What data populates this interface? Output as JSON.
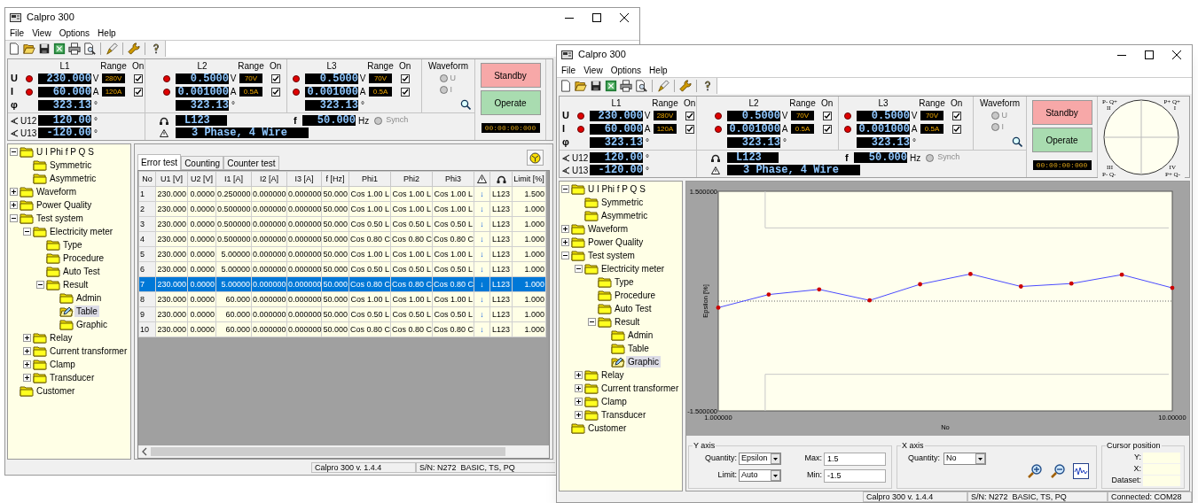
{
  "windows": [
    {
      "title": "Calpro 300",
      "menu": [
        "File",
        "View",
        "Options",
        "Help"
      ],
      "meter": {
        "row_labels": [
          "U",
          "I",
          "φ"
        ],
        "phases": [
          {
            "label": "L1",
            "range_header": "Range",
            "on_header": "On",
            "u": "230.000",
            "u_unit": "V",
            "u_range": "280V",
            "u_on": true,
            "i": "60.000",
            "i_unit": "A",
            "i_range": "120A",
            "i_on": true,
            "phi": "323.13",
            "phi_unit": "°"
          },
          {
            "label": "L2",
            "range_header": "Range",
            "on_header": "On",
            "u": "0.5000",
            "u_unit": "V",
            "u_range": "70V",
            "u_on": true,
            "i": "0.001000",
            "i_unit": "A",
            "i_range": "0.5A",
            "i_on": true,
            "phi": "323.13",
            "phi_unit": "°"
          },
          {
            "label": "L3",
            "range_header": "Range",
            "on_header": "On",
            "u": "0.5000",
            "u_unit": "V",
            "u_range": "70V",
            "u_on": true,
            "i": "0.001000",
            "i_unit": "A",
            "i_range": "0.5A",
            "i_on": true,
            "phi": "323.13",
            "phi_unit": "°"
          }
        ],
        "waveform": {
          "title": "Waveform",
          "options": [
            {
              "label": "U",
              "selected": false,
              "disabled": true
            },
            {
              "label": "I",
              "selected": false,
              "disabled": true
            }
          ]
        },
        "angles": [
          {
            "label": "U12",
            "value": "120.00",
            "unit": "°"
          },
          {
            "label": "U13",
            "value": "-120.00",
            "unit": "°"
          }
        ],
        "sequence": "L123",
        "connection": "3 Phase, 4 Wire",
        "frequency": {
          "label": "f",
          "value": "50.000",
          "unit": "Hz"
        },
        "synch": {
          "label": "Synch",
          "selected": false,
          "disabled": true
        },
        "buttons": [
          {
            "label": "Standby",
            "color": "#f7a8a8"
          },
          {
            "label": "Operate",
            "color": "#a9dcb0"
          }
        ],
        "timer": "00:00:00:000"
      },
      "tree": [
        {
          "label": "U I Phi f P Q S",
          "expanded": true,
          "selected": false,
          "children": [
            {
              "label": "Symmetric",
              "selected": false
            },
            {
              "label": "Asymmetric",
              "selected": false
            }
          ]
        },
        {
          "label": "Waveform",
          "expanded": false,
          "selected": false
        },
        {
          "label": "Power Quality",
          "expanded": false,
          "selected": false
        },
        {
          "label": "Test system",
          "expanded": true,
          "selected": false,
          "children": [
            {
              "label": "Electricity meter",
              "expanded": true,
              "selected": false,
              "children": [
                {
                  "label": "Type",
                  "selected": false
                },
                {
                  "label": "Procedure",
                  "selected": false
                },
                {
                  "label": "Auto Test",
                  "selected": false
                },
                {
                  "label": "Result",
                  "expanded": true,
                  "selected": false,
                  "children": [
                    {
                      "label": "Admin",
                      "selected": false
                    },
                    {
                      "label": "Table",
                      "selected": true
                    },
                    {
                      "label": "Graphic",
                      "selected": false
                    }
                  ]
                }
              ]
            },
            {
              "label": "Relay",
              "expanded": false,
              "selected": false
            },
            {
              "label": "Current transformer",
              "expanded": false,
              "selected": false
            },
            {
              "label": "Clamp",
              "expanded": false,
              "selected": false
            },
            {
              "label": "Transducer",
              "expanded": false,
              "selected": false
            }
          ]
        },
        {
          "label": "Customer",
          "selected": false
        }
      ],
      "content": {
        "kind": "table",
        "tabs": [
          {
            "label": "Error test",
            "selected": true
          },
          {
            "label": "Counting",
            "selected": false
          },
          {
            "label": "Counter test",
            "selected": false
          }
        ],
        "columns": [
          {
            "kind": "text",
            "label": "No"
          },
          {
            "kind": "text",
            "label": "U1 [V]"
          },
          {
            "kind": "text",
            "label": "U2 [V]"
          },
          {
            "kind": "text",
            "label": "I1 [A]"
          },
          {
            "kind": "text",
            "label": "I2 [A]"
          },
          {
            "kind": "text",
            "label": "I3 [A]"
          },
          {
            "kind": "text",
            "label": "f [Hz]"
          },
          {
            "kind": "text",
            "label": "Phi1"
          },
          {
            "kind": "text",
            "label": "Phi2"
          },
          {
            "kind": "text",
            "label": "Phi3"
          },
          {
            "kind": "direction"
          },
          {
            "kind": "sequence"
          },
          {
            "kind": "text",
            "label": "Limit [%]"
          }
        ],
        "rows": [
          {
            "selected": false,
            "cells": [
              "1",
              "230.000",
              "0.0000",
              "0.250000",
              "0.000000",
              "0.000000",
              "50.000",
              "Cos 1.00 L",
              "Cos 1.00 L",
              "Cos 1.00 L",
              "↓",
              "L123",
              "1.500"
            ]
          },
          {
            "selected": false,
            "cells": [
              "2",
              "230.000",
              "0.0000",
              "0.500000",
              "0.000000",
              "0.000000",
              "50.000",
              "Cos 1.00 L",
              "Cos 1.00 L",
              "Cos 1.00 L",
              "↓",
              "L123",
              "1.000"
            ]
          },
          {
            "selected": false,
            "cells": [
              "3",
              "230.000",
              "0.0000",
              "0.500000",
              "0.000000",
              "0.000000",
              "50.000",
              "Cos 0.50 L",
              "Cos 0.50 L",
              "Cos 0.50 L",
              "↓",
              "L123",
              "1.000"
            ]
          },
          {
            "selected": false,
            "cells": [
              "4",
              "230.000",
              "0.0000",
              "0.500000",
              "0.000000",
              "0.000000",
              "50.000",
              "Cos 0.80 C",
              "Cos 0.80 C",
              "Cos 0.80 C",
              "↓",
              "L123",
              "1.000"
            ]
          },
          {
            "selected": false,
            "cells": [
              "5",
              "230.000",
              "0.0000",
              "5.00000",
              "0.000000",
              "0.000000",
              "50.000",
              "Cos 1.00 L",
              "Cos 1.00 L",
              "Cos 1.00 L",
              "↓",
              "L123",
              "1.000"
            ]
          },
          {
            "selected": false,
            "cells": [
              "6",
              "230.000",
              "0.0000",
              "5.00000",
              "0.000000",
              "0.000000",
              "50.000",
              "Cos 0.50 L",
              "Cos 0.50 L",
              "Cos 0.50 L",
              "↓",
              "L123",
              "1.000"
            ]
          },
          {
            "selected": true,
            "cells": [
              "7",
              "230.000",
              "0.0000",
              "5.00000",
              "0.000000",
              "0.000000",
              "50.000",
              "Cos 0.80 C",
              "Cos 0.80 C",
              "Cos 0.80 C",
              "↓",
              "L123",
              "1.000"
            ]
          },
          {
            "selected": false,
            "cells": [
              "8",
              "230.000",
              "0.0000",
              "60.000",
              "0.000000",
              "0.000000",
              "50.000",
              "Cos 1.00 L",
              "Cos 1.00 L",
              "Cos 1.00 L",
              "↓",
              "L123",
              "1.000"
            ]
          },
          {
            "selected": false,
            "cells": [
              "9",
              "230.000",
              "0.0000",
              "60.000",
              "0.000000",
              "0.000000",
              "50.000",
              "Cos 0.50 L",
              "Cos 0.50 L",
              "Cos 0.50 L",
              "↓",
              "L123",
              "1.000"
            ]
          },
          {
            "selected": false,
            "cells": [
              "10",
              "230.000",
              "0.0000",
              "60.000",
              "0.000000",
              "0.000000",
              "50.000",
              "Cos 0.80 C",
              "Cos 0.80 C",
              "Cos 0.80 C",
              "↓",
              "L123",
              "1.000"
            ]
          }
        ]
      },
      "status_bar": [
        "Calpro 300 v. 1.4.4",
        "S/N: N272  BASIC, TS, PQ"
      ]
    },
    {
      "title": "Calpro 300",
      "menu": [
        "File",
        "View",
        "Options",
        "Help"
      ],
      "meter": {
        "row_labels": [
          "U",
          "I",
          "φ"
        ],
        "phases": [
          {
            "label": "L1",
            "range_header": "Range",
            "on_header": "On",
            "u": "230.000",
            "u_unit": "V",
            "u_range": "280V",
            "u_on": true,
            "i": "60.000",
            "i_unit": "A",
            "i_range": "120A",
            "i_on": true,
            "phi": "323.13",
            "phi_unit": "°"
          },
          {
            "label": "L2",
            "range_header": "Range",
            "on_header": "On",
            "u": "0.5000",
            "u_unit": "V",
            "u_range": "70V",
            "u_on": true,
            "i": "0.001000",
            "i_unit": "A",
            "i_range": "0.5A",
            "i_on": true,
            "phi": "323.13",
            "phi_unit": "°"
          },
          {
            "label": "L3",
            "range_header": "Range",
            "on_header": "On",
            "u": "0.5000",
            "u_unit": "V",
            "u_range": "70V",
            "u_on": true,
            "i": "0.001000",
            "i_unit": "A",
            "i_range": "0.5A",
            "i_on": true,
            "phi": "323.13",
            "phi_unit": "°"
          }
        ],
        "waveform": {
          "title": "Waveform",
          "options": [
            {
              "label": "U",
              "selected": false,
              "disabled": true
            },
            {
              "label": "I",
              "selected": false,
              "disabled": true
            }
          ]
        },
        "angles": [
          {
            "label": "U12",
            "value": "120.00",
            "unit": "°"
          },
          {
            "label": "U13",
            "value": "-120.00",
            "unit": "°"
          }
        ],
        "sequence": "L123",
        "connection": "3 Phase, 4 Wire",
        "frequency": {
          "label": "f",
          "value": "50.000",
          "unit": "Hz"
        },
        "synch": {
          "label": "Synch",
          "selected": false,
          "disabled": true
        },
        "buttons": [
          {
            "label": "Standby",
            "color": "#f7a8a8"
          },
          {
            "label": "Operate",
            "color": "#a9dcb0"
          }
        ],
        "timer": "00:00:00:000",
        "pq_diagram": {
          "quadrants": [
            {
              "label": "P- Q+",
              "numeral": "II"
            },
            {
              "label": "P+ Q+",
              "numeral": "I"
            },
            {
              "label": "P- Q-",
              "numeral": "III"
            },
            {
              "label": "P+ Q-",
              "numeral": "IV"
            }
          ]
        }
      },
      "tree": [
        {
          "label": "U I Phi f P Q S",
          "expanded": true,
          "selected": false,
          "children": [
            {
              "label": "Symmetric",
              "selected": false
            },
            {
              "label": "Asymmetric",
              "selected": false
            }
          ]
        },
        {
          "label": "Waveform",
          "expanded": false,
          "selected": false
        },
        {
          "label": "Power Quality",
          "expanded": false,
          "selected": false
        },
        {
          "label": "Test system",
          "expanded": true,
          "selected": false,
          "children": [
            {
              "label": "Electricity meter",
              "expanded": true,
              "selected": false,
              "children": [
                {
                  "label": "Type",
                  "selected": false
                },
                {
                  "label": "Procedure",
                  "selected": false
                },
                {
                  "label": "Auto Test",
                  "selected": false
                },
                {
                  "label": "Result",
                  "expanded": true,
                  "selected": false,
                  "children": [
                    {
                      "label": "Admin",
                      "selected": false
                    },
                    {
                      "label": "Table",
                      "selected": false
                    },
                    {
                      "label": "Graphic",
                      "selected": true
                    }
                  ]
                }
              ]
            },
            {
              "label": "Relay",
              "expanded": false,
              "selected": false
            },
            {
              "label": "Current transformer",
              "expanded": false,
              "selected": false
            },
            {
              "label": "Clamp",
              "expanded": false,
              "selected": false
            },
            {
              "label": "Transducer",
              "expanded": false,
              "selected": false
            }
          ]
        },
        {
          "label": "Customer",
          "selected": false
        }
      ],
      "content": {
        "kind": "graph",
        "chart_data": {
          "type": "line",
          "xlabel": "No",
          "ylabel": "Epsilon [%]",
          "x": [
            1,
            2,
            3,
            4,
            5,
            6,
            7,
            8,
            9,
            10
          ],
          "series": [
            {
              "color": "#4b4bff",
              "values": [
                -0.09,
                0.09,
                0.16,
                0.01,
                0.23,
                0.37,
                0.2,
                0.24,
                0.36,
                0.18
              ]
            }
          ],
          "xlim": [
            1,
            10
          ],
          "ylim": [
            -1.5,
            1.5
          ],
          "xticks": [
            {
              "value": 1,
              "label": "1.000000"
            },
            {
              "value": 10,
              "label": "10.00000"
            }
          ],
          "yticks": [
            {
              "value": 1.5,
              "label": "1.500000"
            },
            {
              "value": -1.5,
              "label": "-1.500000"
            }
          ],
          "ref_lines": [
            {
              "axis": "y",
              "value": 0
            },
            {
              "axis": "y",
              "value": 1
            },
            {
              "axis": "y",
              "value": -1
            },
            {
              "axis": "x",
              "value": 1.93
            }
          ]
        },
        "y_axis": {
          "title": "Y axis",
          "quantity_label": "Quantity:",
          "quantity": "Epsilon",
          "limit_label": "Limit:",
          "limit": "Auto",
          "max_label": "Max:",
          "max": "1.5",
          "min_label": "Min:",
          "min": "-1.5"
        },
        "x_axis": {
          "title": "X axis",
          "quantity_label": "Quantity:",
          "quantity": "No"
        },
        "cursor": {
          "title": "Cursor position",
          "fields": [
            "Y:",
            "X:",
            "Dataset:"
          ]
        }
      },
      "status_bar": [
        "Calpro 300 v. 1.4.4",
        "S/N: N272  BASIC, TS, PQ",
        "Connected: COM28"
      ]
    }
  ]
}
